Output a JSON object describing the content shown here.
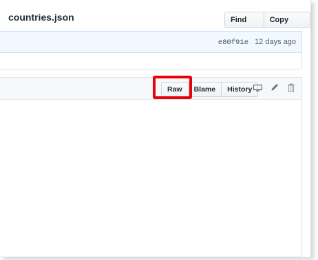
{
  "file": {
    "name": "countries.json"
  },
  "file_nav": {
    "find_file": "Find file",
    "copy_path": "Copy path"
  },
  "commit": {
    "sha": "e80f91e",
    "age": "12 days ago"
  },
  "file_actions": {
    "raw": "Raw",
    "blame": "Blame",
    "history": "History"
  },
  "icons": [
    "desktop-icon",
    "pencil-icon",
    "trash-icon"
  ],
  "colors": {
    "highlight": "#e8000b",
    "commit_bg": "#f1f8ff",
    "header_bg": "#f6f8fa"
  }
}
